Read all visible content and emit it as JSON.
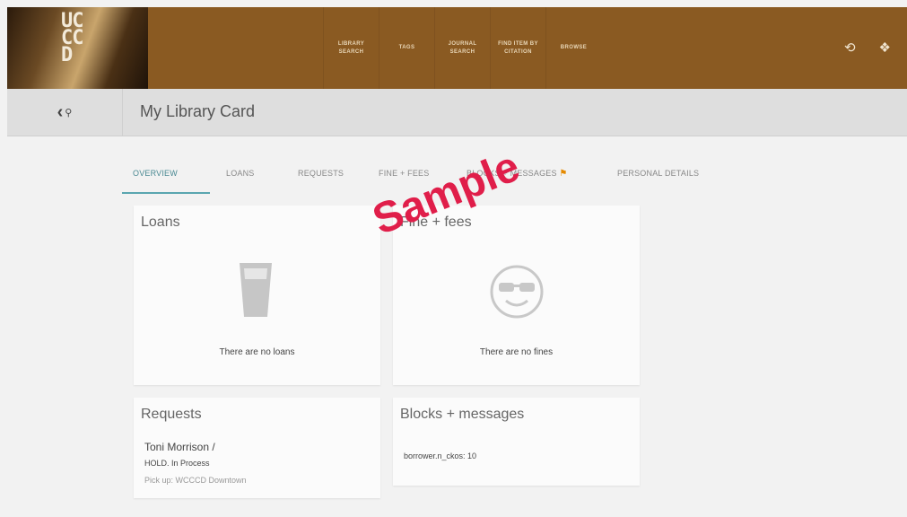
{
  "header": {
    "logo_text": "UC\nCC\nD",
    "nav": [
      {
        "label": "LIBRARY\nSEARCH"
      },
      {
        "label": "TAGS"
      },
      {
        "label": "JOURNAL\nSEARCH"
      },
      {
        "label": "FIND ITEM BY\nCITATION"
      },
      {
        "label": "BROWSE"
      }
    ],
    "icons": [
      "history-icon",
      "pin-icon"
    ]
  },
  "subbar": {
    "title": "My Library Card"
  },
  "tabs": [
    {
      "label": "OVERVIEW"
    },
    {
      "label": "LOANS"
    },
    {
      "label": "REQUESTS"
    },
    {
      "label": "FINE + FEES"
    },
    {
      "label": "BLOCKS + MESSAGES"
    },
    {
      "label": "PERSONAL DETAILS"
    }
  ],
  "cards": {
    "loans": {
      "title": "Loans",
      "message": "There are no loans"
    },
    "fines": {
      "title": "Fine + fees",
      "message": "There are no fines"
    },
    "requests": {
      "title": "Requests",
      "item_title": "Toni Morrison /",
      "status": "HOLD. In Process",
      "pickup": "Pick up: WCCCD Downtown"
    },
    "blocks": {
      "title": "Blocks + messages",
      "message": "borrower.n_ckos: 10"
    }
  },
  "watermark": "Sample",
  "colors": {
    "header": "#8a5a22",
    "accent": "#5aa6b0",
    "watermark": "#e01e4a"
  }
}
